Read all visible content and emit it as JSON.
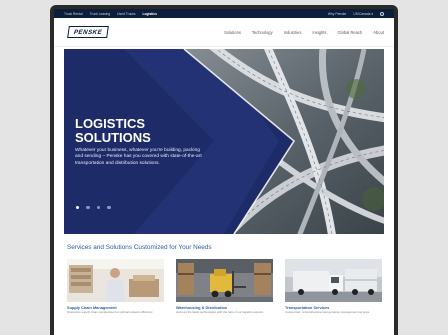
{
  "utility_nav": {
    "left_links": [
      "Truck Rental",
      "Truck Leasing",
      "Used Trucks",
      "Logistics"
    ],
    "active": "Logistics",
    "right_links": [
      "Why Penske",
      "US/Canada ▾"
    ]
  },
  "header": {
    "logo_text": "PENSKE",
    "nav": [
      "Solutions",
      "Technology",
      "Industries",
      "Insights",
      "Global Reach",
      "About"
    ]
  },
  "hero": {
    "title": "LOGISTICS SOLUTIONS",
    "subtitle": "Whatever your business, whatever you're building, packing and sending – Penske has you covered with state-of-the-art transportation and distribution solutions.",
    "slide_count": 4,
    "active_slide": 1
  },
  "services": {
    "heading": "Services and Solutions Customized for Your Needs",
    "cards": [
      {
        "title": "Supply Chain Management",
        "desc": "Streamline supply chain complexities for optimal network efficiency."
      },
      {
        "title": "Warehousing & Distribution",
        "desc": "Harness the latest technologies with the help of our logistics experts."
      },
      {
        "title": "Transportation Services",
        "desc": "Customized, comprehensive transportation management services."
      }
    ]
  },
  "colors": {
    "brand_navy": "#0c1e3b",
    "hero_blue": "#1d2b68",
    "link_blue": "#2a5aa6"
  }
}
